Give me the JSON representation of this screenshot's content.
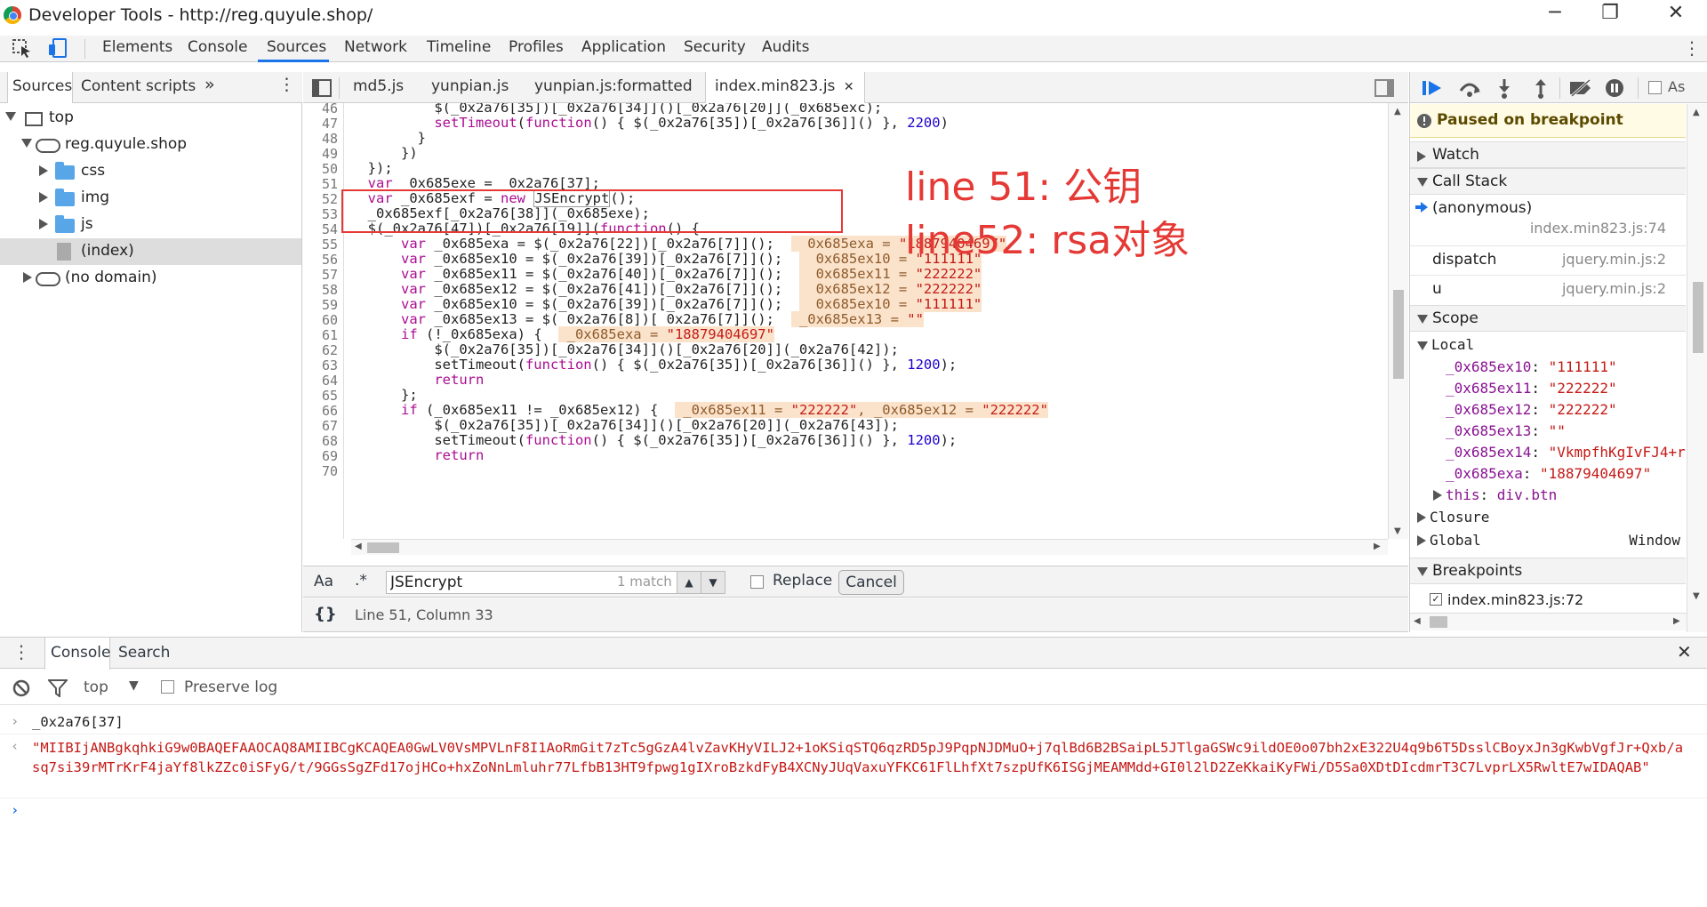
{
  "window": {
    "title": "Developer Tools - http://reg.quyule.shop/",
    "minimize": "─",
    "restore": "❐",
    "close": "✕"
  },
  "main_tabs": [
    "Elements",
    "Console",
    "Sources",
    "Network",
    "Timeline",
    "Profiles",
    "Application",
    "Security",
    "Audits"
  ],
  "main_tabs_active": "Sources",
  "navigator": {
    "tabs": [
      "Sources",
      "Content scripts"
    ],
    "more": "»",
    "menu": "⋮",
    "tree": {
      "top": "top",
      "domain": "reg.quyule.shop",
      "folders": [
        "css",
        "img",
        "js"
      ],
      "selected_file": "(index)",
      "no_domain": "(no domain)"
    }
  },
  "editor": {
    "tabs": [
      "md5.js",
      "yunpian.js",
      "yunpian.js:formatted",
      "index.min823.js"
    ],
    "active_tab": "index.min823.js",
    "close_glyph": "✕",
    "line_numbers": [
      "46",
      "47",
      "48",
      "49",
      "50",
      "51",
      "52",
      "53",
      "54",
      "55",
      "56",
      "57",
      "58",
      "59",
      "60",
      "61",
      "62",
      "63",
      "64",
      "65",
      "66",
      "67",
      "68",
      "69",
      "70"
    ]
  },
  "annotation": {
    "line1": "line 51: 公钥",
    "line2": "line52: rsa对象",
    "color": "#e53935"
  },
  "search": {
    "aa_label": "Aa",
    "regex_label": ".*",
    "query": "JSEncrypt",
    "match_count": "1 match",
    "replace_label": "Replace",
    "cancel_label": "Cancel"
  },
  "status": {
    "braces": "{}",
    "position": "Line 51, Column 33"
  },
  "debugger": {
    "paused_text": "Paused on breakpoint",
    "async_label": "As",
    "sections": {
      "watch": "Watch",
      "call_stack": "Call Stack",
      "scope": "Scope",
      "breakpoints": "Breakpoints"
    },
    "call_stack": [
      {
        "fn": "(anonymous)",
        "loc": "index.min823.js:74"
      },
      {
        "fn": "dispatch",
        "loc": "jquery.min.js:2"
      },
      {
        "fn": "u",
        "loc": "jquery.min.js:2"
      }
    ],
    "scope": {
      "local_label": "Local",
      "vars": [
        {
          "name": "_0x685ex10",
          "value": "\"111111\""
        },
        {
          "name": "_0x685ex11",
          "value": "\"222222\""
        },
        {
          "name": "_0x685ex12",
          "value": "\"222222\""
        },
        {
          "name": "_0x685ex13",
          "value": "\"\""
        },
        {
          "name": "_0x685ex14",
          "value": "\"VkmpfhKgIvFJ4+r"
        },
        {
          "name": "_0x685exa",
          "value": "\"18879404697\""
        }
      ],
      "this_name": "this",
      "this_value": "div.btn",
      "closure_label": "Closure",
      "global_label": "Global",
      "global_value": "Window"
    },
    "breakpoint_item": "index.min823.js:72"
  },
  "drawer": {
    "tabs": [
      "Console",
      "Search"
    ],
    "context": "top",
    "preserve_log": "Preserve log",
    "input_echo": "_0x2a76[37]",
    "output": "\"MIIBIjANBgkqhkiG9w0BAQEFAAOCAQ8AMIIBCgKCAQEA0GwLV0VsMPVLnF8I1AoRmGit7zTc5gGzA4lvZavKHyVILJ2+1oKSiqSTQ6qzRD5pJ9PqpNJDMuO+j7qlBd6B2BSaipL5JTlgaGSWc9ildOE0o07bh2xE322U4q9b6T5DsslCBoyxJn3gKwbVgfJr+Qxb/asq7si39rMTrKrF4jaYf8lkZZc0iSFyG/t/9GGsSgZFd17ojHCo+hxZoNnLmluhr77LfbB13HT9fpwg1gIXroBzkdFyB4XCNyJUqVaxuYFKC61FlLhfXt7szpUfK6ISGjMEAMMdd+GI0l2lD2ZeKkaiKyFWi/D5Sa0XDtDIcdmrT3C7LvprLX5RwltE7wIDAQAB\"",
    "prompt": "›"
  }
}
